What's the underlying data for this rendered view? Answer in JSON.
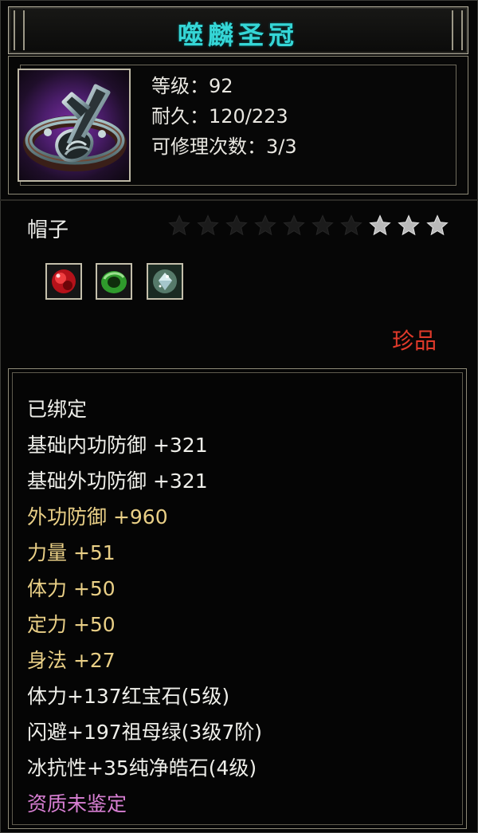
{
  "item": {
    "name": "噬麟圣冠",
    "icon": "crown-icon",
    "level": "等级：92",
    "durability": "耐久：120/223",
    "repairs": "可修理次数：3/3",
    "slot": "帽子",
    "stars_filled": 3,
    "stars_total": 10,
    "gems": [
      {
        "icon": "red-ruby-gem-icon",
        "color": "#c0131b"
      },
      {
        "icon": "green-emerald-ring-icon",
        "color": "#2f9a2c"
      },
      {
        "icon": "white-diamond-gem-icon",
        "color": "#cfe6e9"
      }
    ],
    "rarity": "珍品"
  },
  "attributes": [
    {
      "text": "已绑定",
      "color": "white"
    },
    {
      "text": "基础内功防御  +321",
      "color": "white"
    },
    {
      "text": "基础外功防御  +321",
      "color": "white"
    },
    {
      "text": "外功防御  +960",
      "color": "gold"
    },
    {
      "text": "力量  +51",
      "color": "gold"
    },
    {
      "text": "体力  +50",
      "color": "gold"
    },
    {
      "text": "定力  +50",
      "color": "gold"
    },
    {
      "text": "身法  +27",
      "color": "gold"
    },
    {
      "text": "体力+137红宝石(5级)",
      "color": "white"
    },
    {
      "text": "闪避+197祖母绿(3级7阶)",
      "color": "white"
    },
    {
      "text": "冰抗性+35纯净皓石(4级)",
      "color": "white"
    },
    {
      "text": "资质未鉴定",
      "color": "pink"
    }
  ],
  "colors": {
    "title": "#35d6d6",
    "rarity": "#e03a2a",
    "gold_text": "#e9cf86",
    "pink_text": "#d87fd3"
  }
}
